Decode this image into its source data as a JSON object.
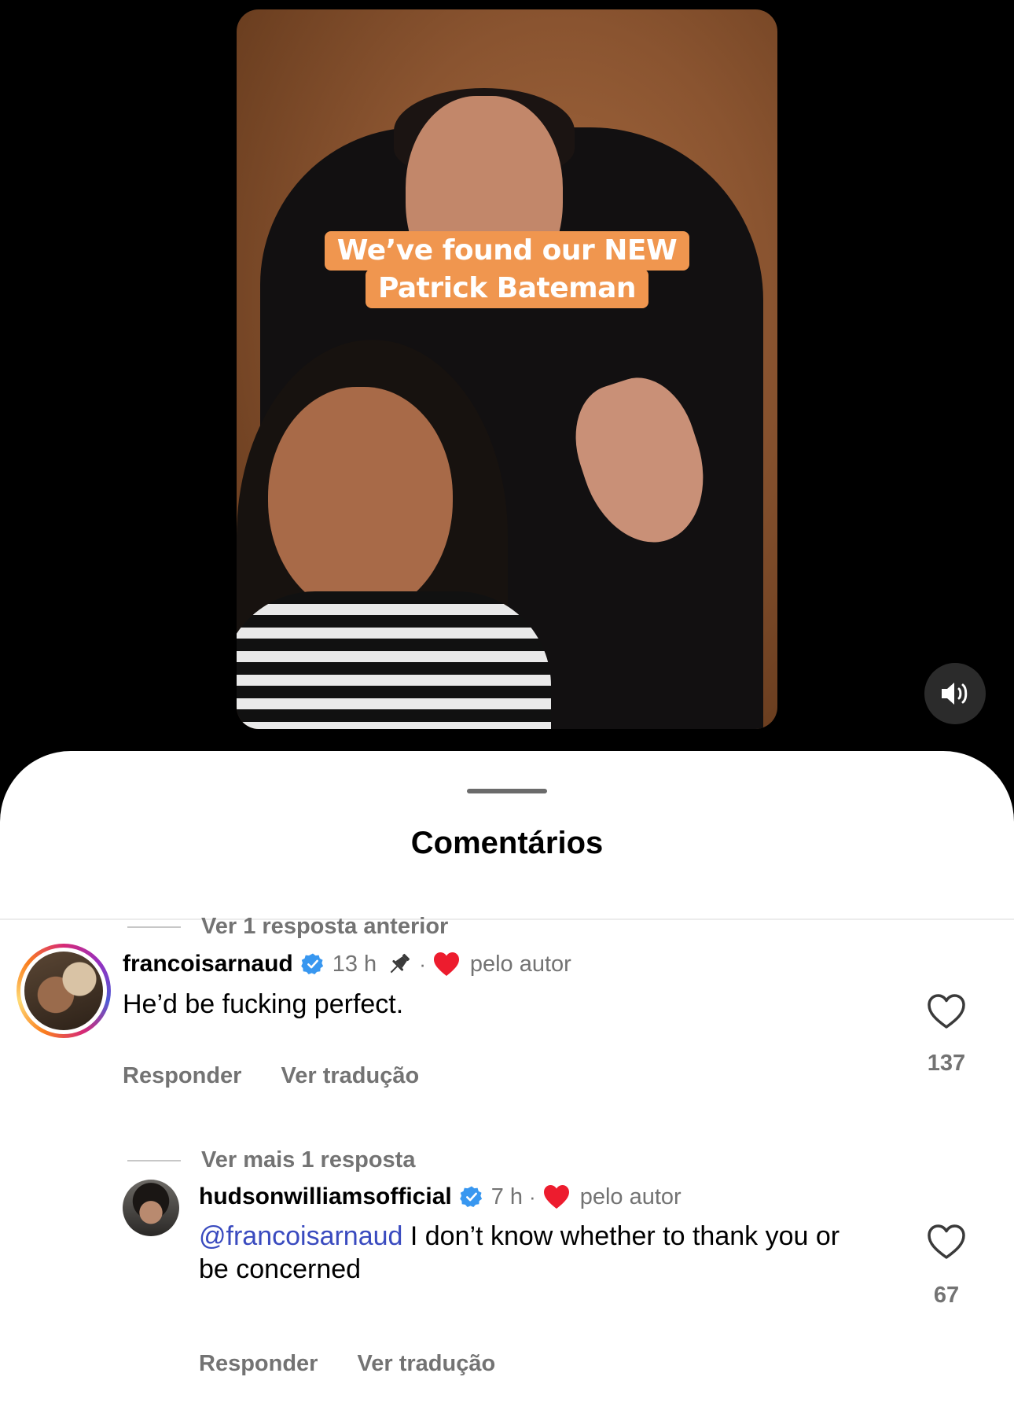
{
  "video": {
    "caption_line1": "We’ve found our NEW",
    "caption_line2": "Patrick Bateman",
    "sound_icon": "speaker-on-icon"
  },
  "sheet": {
    "title": "Comentários"
  },
  "comments": [
    {
      "username": "francoisarnaud",
      "verified": true,
      "time": "13 h",
      "pinned": true,
      "separator": "·",
      "liked_by_author_label": "pelo autor",
      "text": "He’d be fucking perfect.",
      "reply_label": "Responder",
      "translate_label": "Ver tradução",
      "likes": "137",
      "replies_label": "Ver 1 resposta anterior"
    },
    {
      "username": "hudsonwilliamsofficial",
      "verified": true,
      "time": "7 h",
      "separator": "·",
      "liked_by_author_label": "pelo autor",
      "mention": "@francoisarnaud",
      "text": " I don’t know whether to thank you or be concerned",
      "reply_label": "Responder",
      "translate_label": "Ver tradução",
      "likes": "67",
      "replies_label": "Ver mais 1 resposta"
    }
  ],
  "colors": {
    "caption_bg": "#f0964f",
    "verified": "#3897f0",
    "heart_red": "#ed1c2e",
    "mention": "#3a4bbf",
    "secondary_text": "#737373"
  }
}
